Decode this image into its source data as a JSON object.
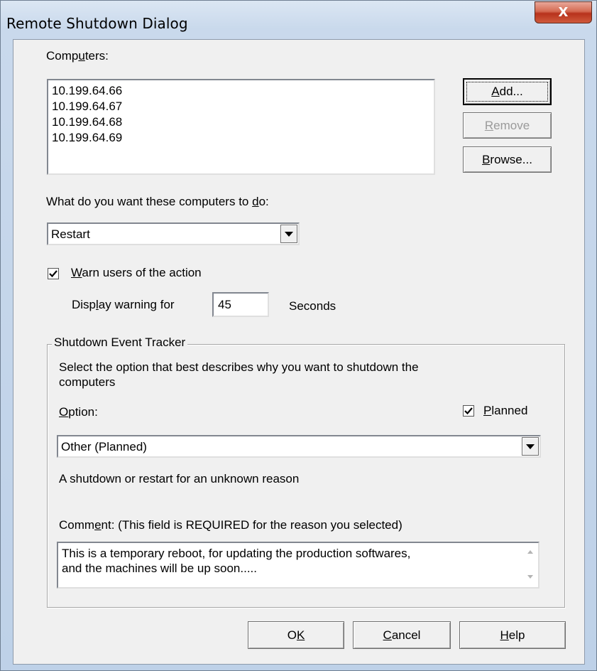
{
  "window": {
    "title": "Remote Shutdown Dialog",
    "close_label": "X"
  },
  "computers": {
    "label_pre": "Comp",
    "label_ul": "u",
    "label_post": "ters:",
    "items": [
      "10.199.64.66",
      "10.199.64.67",
      "10.199.64.68",
      "10.199.64.69"
    ]
  },
  "buttons": {
    "add_ul": "A",
    "add_post": "dd...",
    "remove_ul": "R",
    "remove_post": "emove",
    "browse_ul": "B",
    "browse_post": "rowse..."
  },
  "action": {
    "label_pre": "What do you want these computers to ",
    "label_ul": "d",
    "label_post": "o:",
    "selected": "Restart"
  },
  "warn": {
    "checked": true,
    "label_ul": "W",
    "label_post": "arn users of the action",
    "display_pre": "Disp",
    "display_ul": "l",
    "display_post": "ay warning for",
    "seconds_value": "45",
    "seconds_label": "Seconds"
  },
  "tracker": {
    "legend": "Shutdown Event Tracker",
    "description_line1": "Select the option that best describes why you want to shutdown the",
    "description_line2": "computers",
    "option_ul": "O",
    "option_post": "ption:",
    "planned_checked": true,
    "planned_ul": "P",
    "planned_post": "lanned",
    "selected_option": "Other (Planned)",
    "reason_text": "A shutdown or restart for an unknown reason",
    "comment_pre": "Comm",
    "comment_ul": "e",
    "comment_post": "nt: (This field is REQUIRED for the reason you selected)",
    "comment_line1": "This is a temporary reboot, for updating the production softwares,",
    "comment_line2": "and the machines will be up soon....."
  },
  "footer": {
    "ok_pre": "O",
    "ok_ul": "K",
    "cancel_ul": "C",
    "cancel_post": "ancel",
    "help_ul": "H",
    "help_post": "elp"
  }
}
